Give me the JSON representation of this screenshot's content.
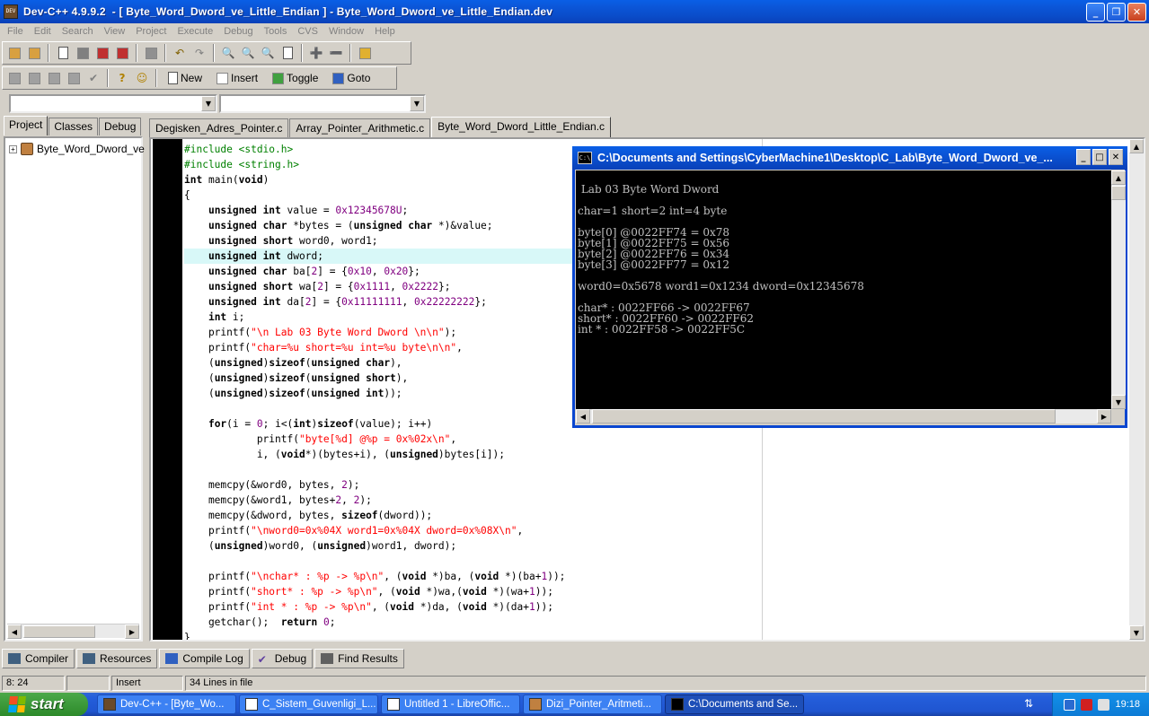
{
  "window": {
    "title": "Dev-C++ 4.9.9.2  - [ Byte_Word_Dword_ve_Little_Endian ] - Byte_Word_Dword_ve_Little_Endian.dev",
    "icon_text": "DEV",
    "minimize": "_",
    "maximize": "❐",
    "close": "✕"
  },
  "menu": [
    "File",
    "Edit",
    "Search",
    "View",
    "Project",
    "Execute",
    "Debug",
    "Tools",
    "CVS",
    "Window",
    "Help"
  ],
  "toolbar2": {
    "new_label": "New",
    "insert_label": "Insert",
    "toggle_label": "Toggle",
    "goto_label": "Goto"
  },
  "left_tabs": [
    "Project",
    "Classes",
    "Debug"
  ],
  "project_tree": {
    "item": "Byte_Word_Dword_ve"
  },
  "editor_tabs": [
    "Degisken_Adres_Pointer.c",
    "Array_Pointer_Arithmetic.c",
    "Byte_Word_Dword_Little_Endian.c"
  ],
  "code_lines": [
    [
      [
        "pp",
        "#include <stdio.h>"
      ]
    ],
    [
      [
        "pp",
        "#include <string.h>"
      ]
    ],
    [
      [
        "kw",
        "int"
      ],
      [
        "t",
        " main("
      ],
      [
        "kw",
        "void"
      ],
      [
        "t",
        ")"
      ]
    ],
    [
      [
        "t",
        "{"
      ]
    ],
    [
      [
        "t",
        "    "
      ],
      [
        "kw",
        "unsigned int"
      ],
      [
        "t",
        " value = "
      ],
      [
        "num",
        "0x12345678U"
      ],
      [
        "t",
        ";"
      ]
    ],
    [
      [
        "t",
        "    "
      ],
      [
        "kw",
        "unsigned char"
      ],
      [
        "t",
        " *bytes = ("
      ],
      [
        "kw",
        "unsigned char"
      ],
      [
        "t",
        " *)&value;"
      ]
    ],
    [
      [
        "t",
        "    "
      ],
      [
        "kw",
        "unsigned short"
      ],
      [
        "t",
        " word0, word1;"
      ]
    ],
    [
      [
        "t",
        "    "
      ],
      [
        "kw",
        "unsigned int"
      ],
      [
        "t",
        " dword;"
      ]
    ],
    [
      [
        "t",
        "    "
      ],
      [
        "kw",
        "unsigned char"
      ],
      [
        "t",
        " ba["
      ],
      [
        "num",
        "2"
      ],
      [
        "t",
        "] = {"
      ],
      [
        "num",
        "0x10"
      ],
      [
        "t",
        ", "
      ],
      [
        "num",
        "0x20"
      ],
      [
        "t",
        "};"
      ]
    ],
    [
      [
        "t",
        "    "
      ],
      [
        "kw",
        "unsigned short"
      ],
      [
        "t",
        " wa["
      ],
      [
        "num",
        "2"
      ],
      [
        "t",
        "] = {"
      ],
      [
        "num",
        "0x1111"
      ],
      [
        "t",
        ", "
      ],
      [
        "num",
        "0x2222"
      ],
      [
        "t",
        "};"
      ]
    ],
    [
      [
        "t",
        "    "
      ],
      [
        "kw",
        "unsigned int"
      ],
      [
        "t",
        " da["
      ],
      [
        "num",
        "2"
      ],
      [
        "t",
        "] = {"
      ],
      [
        "num",
        "0x11111111"
      ],
      [
        "t",
        ", "
      ],
      [
        "num",
        "0x22222222"
      ],
      [
        "t",
        "};"
      ]
    ],
    [
      [
        "t",
        "    "
      ],
      [
        "kw",
        "int"
      ],
      [
        "t",
        " i;"
      ]
    ],
    [
      [
        "t",
        "    printf("
      ],
      [
        "str",
        "\"\\n Lab 03 Byte Word Dword \\n\\n\""
      ],
      [
        "t",
        ");"
      ]
    ],
    [
      [
        "t",
        "    printf("
      ],
      [
        "str",
        "\"char=%u short=%u int=%u byte\\n\\n\""
      ],
      [
        "t",
        ","
      ]
    ],
    [
      [
        "t",
        "    ("
      ],
      [
        "kw",
        "unsigned"
      ],
      [
        "t",
        ")"
      ],
      [
        "kw",
        "sizeof"
      ],
      [
        "t",
        "("
      ],
      [
        "kw",
        "unsigned char"
      ],
      [
        "t",
        "),"
      ]
    ],
    [
      [
        "t",
        "    ("
      ],
      [
        "kw",
        "unsigned"
      ],
      [
        "t",
        ")"
      ],
      [
        "kw",
        "sizeof"
      ],
      [
        "t",
        "("
      ],
      [
        "kw",
        "unsigned short"
      ],
      [
        "t",
        "),"
      ]
    ],
    [
      [
        "t",
        "    ("
      ],
      [
        "kw",
        "unsigned"
      ],
      [
        "t",
        ")"
      ],
      [
        "kw",
        "sizeof"
      ],
      [
        "t",
        "("
      ],
      [
        "kw",
        "unsigned int"
      ],
      [
        "t",
        "));"
      ]
    ],
    [
      [
        "t",
        ""
      ]
    ],
    [
      [
        "t",
        "    "
      ],
      [
        "kw",
        "for"
      ],
      [
        "t",
        "(i = "
      ],
      [
        "num",
        "0"
      ],
      [
        "t",
        "; i<("
      ],
      [
        "kw",
        "int"
      ],
      [
        "t",
        ")"
      ],
      [
        "kw",
        "sizeof"
      ],
      [
        "t",
        "(value); i++)"
      ]
    ],
    [
      [
        "t",
        "            printf("
      ],
      [
        "str",
        "\"byte[%d] @%p = 0x%02x\\n\""
      ],
      [
        "t",
        ","
      ]
    ],
    [
      [
        "t",
        "            i, ("
      ],
      [
        "kw",
        "void"
      ],
      [
        "t",
        "*)(bytes+i), ("
      ],
      [
        "kw",
        "unsigned"
      ],
      [
        "t",
        ")bytes[i]);"
      ]
    ],
    [
      [
        "t",
        ""
      ]
    ],
    [
      [
        "t",
        "    memcpy(&word0, bytes, "
      ],
      [
        "num",
        "2"
      ],
      [
        "t",
        ");"
      ]
    ],
    [
      [
        "t",
        "    memcpy(&word1, bytes+"
      ],
      [
        "num",
        "2"
      ],
      [
        "t",
        ", "
      ],
      [
        "num",
        "2"
      ],
      [
        "t",
        ");"
      ]
    ],
    [
      [
        "t",
        "    memcpy(&dword, bytes, "
      ],
      [
        "kw",
        "sizeof"
      ],
      [
        "t",
        "(dword));"
      ]
    ],
    [
      [
        "t",
        "    printf("
      ],
      [
        "str",
        "\"\\nword0=0x%04X word1=0x%04X dword=0x%08X\\n\""
      ],
      [
        "t",
        ","
      ]
    ],
    [
      [
        "t",
        "    ("
      ],
      [
        "kw",
        "unsigned"
      ],
      [
        "t",
        ")word0, ("
      ],
      [
        "kw",
        "unsigned"
      ],
      [
        "t",
        ")word1, dword);"
      ]
    ],
    [
      [
        "t",
        ""
      ]
    ],
    [
      [
        "t",
        "    printf("
      ],
      [
        "str",
        "\"\\nchar* : %p -> %p\\n\""
      ],
      [
        "t",
        ", ("
      ],
      [
        "kw",
        "void"
      ],
      [
        "t",
        " *)ba, ("
      ],
      [
        "kw",
        "void"
      ],
      [
        "t",
        " *)(ba+"
      ],
      [
        "num",
        "1"
      ],
      [
        "t",
        "));"
      ]
    ],
    [
      [
        "t",
        "    printf("
      ],
      [
        "str",
        "\"short* : %p -> %p\\n\""
      ],
      [
        "t",
        ", ("
      ],
      [
        "kw",
        "void"
      ],
      [
        "t",
        " *)wa,("
      ],
      [
        "kw",
        "void"
      ],
      [
        "t",
        " *)(wa+"
      ],
      [
        "num",
        "1"
      ],
      [
        "t",
        "));"
      ]
    ],
    [
      [
        "t",
        "    printf("
      ],
      [
        "str",
        "\"int * : %p -> %p\\n\""
      ],
      [
        "t",
        ", ("
      ],
      [
        "kw",
        "void"
      ],
      [
        "t",
        " *)da, ("
      ],
      [
        "kw",
        "void"
      ],
      [
        "t",
        " *)(da+"
      ],
      [
        "num",
        "1"
      ],
      [
        "t",
        "));"
      ]
    ],
    [
      [
        "t",
        "    getchar();  "
      ],
      [
        "kw",
        "return"
      ],
      [
        "t",
        " "
      ],
      [
        "num",
        "0"
      ],
      [
        "t",
        ";"
      ]
    ],
    [
      [
        "t",
        "}"
      ]
    ]
  ],
  "highlighted_line": 7,
  "console": {
    "title": "C:\\Documents and Settings\\CyberMachine1\\Desktop\\C_Lab\\Byte_Word_Dword_ve_...",
    "icon_text": "C:\\",
    "lines": [
      " Lab 03 Byte Word Dword",
      "",
      "char=1 short=2 int=4 byte",
      "",
      "byte[0] @0022FF74 = 0x78",
      "byte[1] @0022FF75 = 0x56",
      "byte[2] @0022FF76 = 0x34",
      "byte[3] @0022FF77 = 0x12",
      "",
      "word0=0x5678 word1=0x1234 dword=0x12345678",
      "",
      "char* : 0022FF66 -> 0022FF67",
      "short* : 0022FF60 -> 0022FF62",
      "int * : 0022FF58 -> 0022FF5C"
    ]
  },
  "bottom_tabs": [
    "Compiler",
    "Resources",
    "Compile Log",
    "Debug",
    "Find Results"
  ],
  "status": {
    "position": "8: 24",
    "mode": "Insert",
    "lines": "34 Lines in file"
  },
  "taskbar": {
    "start": "start",
    "tasks": [
      "Dev-C++ - [Byte_Wo...",
      "C_Sistem_Guvenligi_L...",
      "Untitled 1 - LibreOffic...",
      "Dizi_Pointer_Aritmeti...",
      "C:\\Documents and Se..."
    ],
    "active_task": 4,
    "clock": "19:18"
  },
  "colors": {
    "keyword": "#000000",
    "preprocessor": "#008000",
    "string": "#ff0000",
    "number": "#800080",
    "titlebar": "#0a4cc9"
  }
}
